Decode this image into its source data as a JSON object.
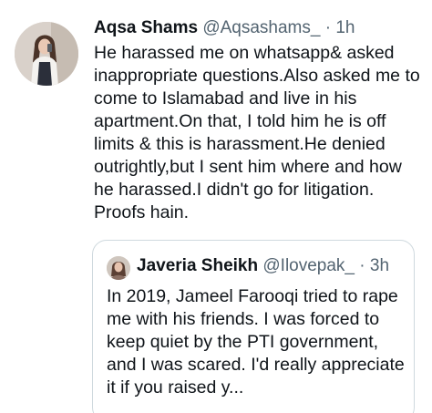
{
  "tweet": {
    "author_name": "Aqsa Shams",
    "author_handle": "@Aqsashams_",
    "separator": "·",
    "timestamp": "1h",
    "text": "He harassed me on whatsapp& asked inappropriate questions.Also asked me to come to Islamabad and live in his apartment.On that, I told him he is off limits & this is harassment.He denied outrightly,but I sent him where and how he harassed.I didn't go for litigation. Proofs hain."
  },
  "quoted_tweet": {
    "author_name": "Javeria Sheikh",
    "author_handle": "@Ilovepak_",
    "separator": "·",
    "timestamp": "3h",
    "text": "In 2019, Jameel Farooqi tried to rape me with his friends. I was forced to keep quiet by the PTI government, and I was scared. I'd really appreciate it if you raised y..."
  }
}
